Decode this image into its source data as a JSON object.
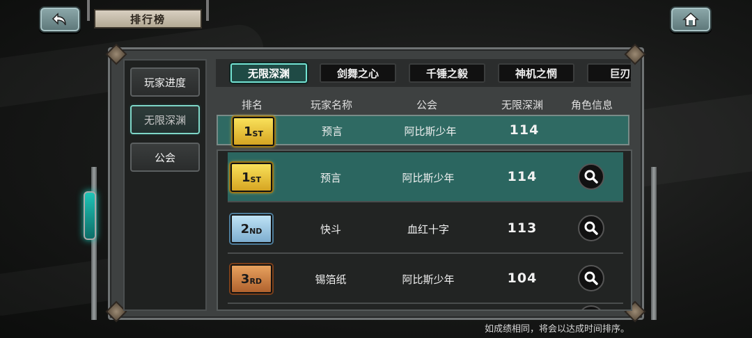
{
  "header": {
    "title": "排行榜",
    "back_icon": "back-arrow-icon",
    "home_icon": "home-icon"
  },
  "sidebar": {
    "items": [
      {
        "label": "玩家进度",
        "active": false
      },
      {
        "label": "无限深渊",
        "active": true
      },
      {
        "label": "公会",
        "active": false
      }
    ]
  },
  "tabs": [
    {
      "label": "无限深渊",
      "active": true
    },
    {
      "label": "剑舞之心",
      "active": false
    },
    {
      "label": "千锤之毅",
      "active": false
    },
    {
      "label": "神机之惘",
      "active": false
    },
    {
      "label": "巨刃之",
      "active": false
    }
  ],
  "columns": {
    "rank": "排名",
    "player": "玩家名称",
    "guild": "公会",
    "score": "无限深渊",
    "info": "角色信息"
  },
  "my_rank": {
    "rank": "1",
    "suffix": "ST",
    "player": "预言",
    "guild": "阿比斯少年",
    "score": "114"
  },
  "rows": [
    {
      "rank": "1",
      "suffix": "ST",
      "tier": "gold",
      "player": "预言",
      "guild": "阿比斯少年",
      "score": "114",
      "info_icon": "magnifier-icon"
    },
    {
      "rank": "2",
      "suffix": "ND",
      "tier": "silver",
      "player": "快斗",
      "guild": "血红十字",
      "score": "113",
      "info_icon": "magnifier-icon"
    },
    {
      "rank": "3",
      "suffix": "RD",
      "tier": "bronze",
      "player": "锡箔纸",
      "guild": "阿比斯少年",
      "score": "104",
      "info_icon": "magnifier-icon"
    }
  ],
  "footer_note": "如成绩相同，将会以达成时间排序。",
  "colors": {
    "accent_teal": "#2b6660",
    "tab_border": "#73e3d3",
    "gold": "#f9e15a",
    "silver": "#bfe3f6",
    "bronze": "#e8a25e"
  }
}
